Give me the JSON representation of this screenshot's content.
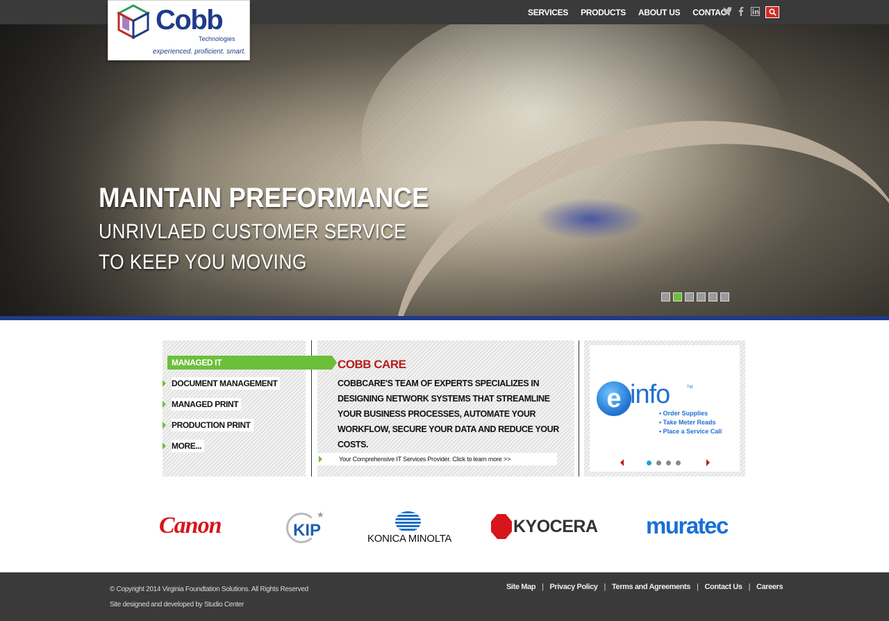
{
  "logo": {
    "name": "Cobb",
    "sub": "Technologies",
    "tagline": "experienced. proficient. smart."
  },
  "nav": {
    "items": [
      "SERVICES",
      "PRODUCTS",
      "ABOUT US",
      "CONTACT"
    ]
  },
  "hero": {
    "title": "MAINTAIN PREFORMANCE",
    "line1": "UNRIVLAED CUSTOMER SERVICE",
    "line2": "TO KEEP YOU MOVING",
    "slide_count": 6,
    "active_slide": 2
  },
  "menu": {
    "items": [
      "MANAGED IT",
      "DOCUMENT MANAGEMENT",
      "MANAGED PRINT",
      "PRODUCTION PRINT",
      "MORE..."
    ],
    "active": 0
  },
  "feature": {
    "title": "COBB CARE",
    "body": "CobbCare's team of experts specializes in designing network systems that streamline your business processes, automate your workflow, secure your data and reduce your costs.",
    "link": "Your Comprehensive IT Services Provider. Click to learn more >>"
  },
  "ad": {
    "brand": "info",
    "tm": "TM",
    "bullets": [
      "• Order Supplies",
      "• Take Meter Reads",
      "• Place a Service Call"
    ],
    "dot_count": 4,
    "active_dot": 1
  },
  "brands": {
    "canon": "Canon",
    "kip": "KIP",
    "konica": "KONICA MINOLTA",
    "kyocera": "KYOCERA",
    "muratec": "muratec"
  },
  "footer": {
    "copyright": "© Copyright 2014 Virginia Foundtation Solutions. All Rights Reserved",
    "credit": "Site designed and developed by Studio Center",
    "links": [
      "Site Map",
      "Privacy Policy",
      "Terms and Agreements",
      "Contact Us",
      "Careers"
    ]
  },
  "colors": {
    "topbar": "#3a3a3a",
    "accent_green": "#6cbf3a",
    "brand_blue": "#1f3a8a",
    "feature_red": "#b71c1c",
    "search_red": "#d12a1f"
  }
}
